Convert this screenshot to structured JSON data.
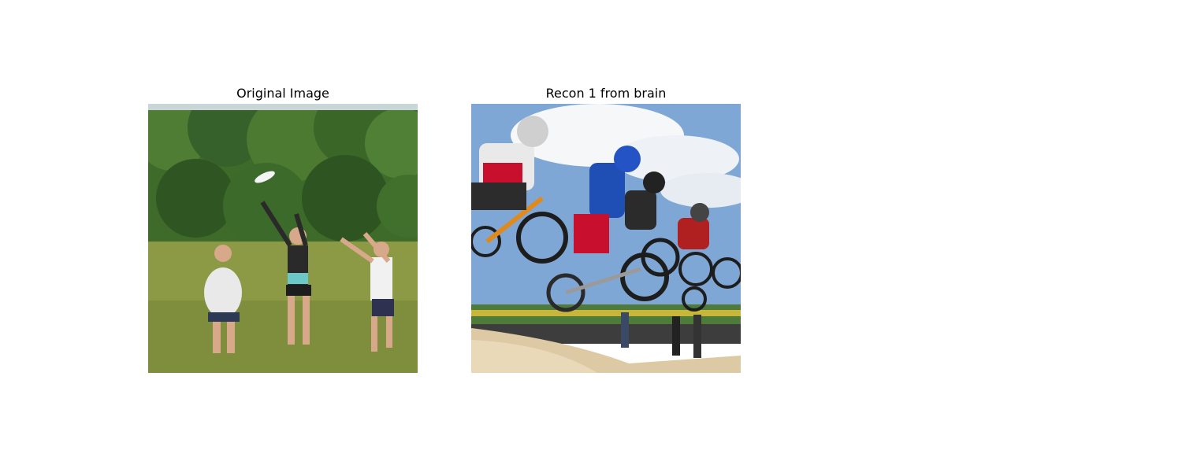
{
  "figure": {
    "panels": [
      {
        "title": "Original Image",
        "image_subject": "three women playing frisbee on a grassy field in front of trees"
      },
      {
        "title": "Recon 1 from brain",
        "image_subject": "BMX riders jumping mid-air over a dirt track under a cloudy sky"
      }
    ]
  },
  "colors": {
    "background": "#ffffff",
    "title_text": "#000000"
  }
}
